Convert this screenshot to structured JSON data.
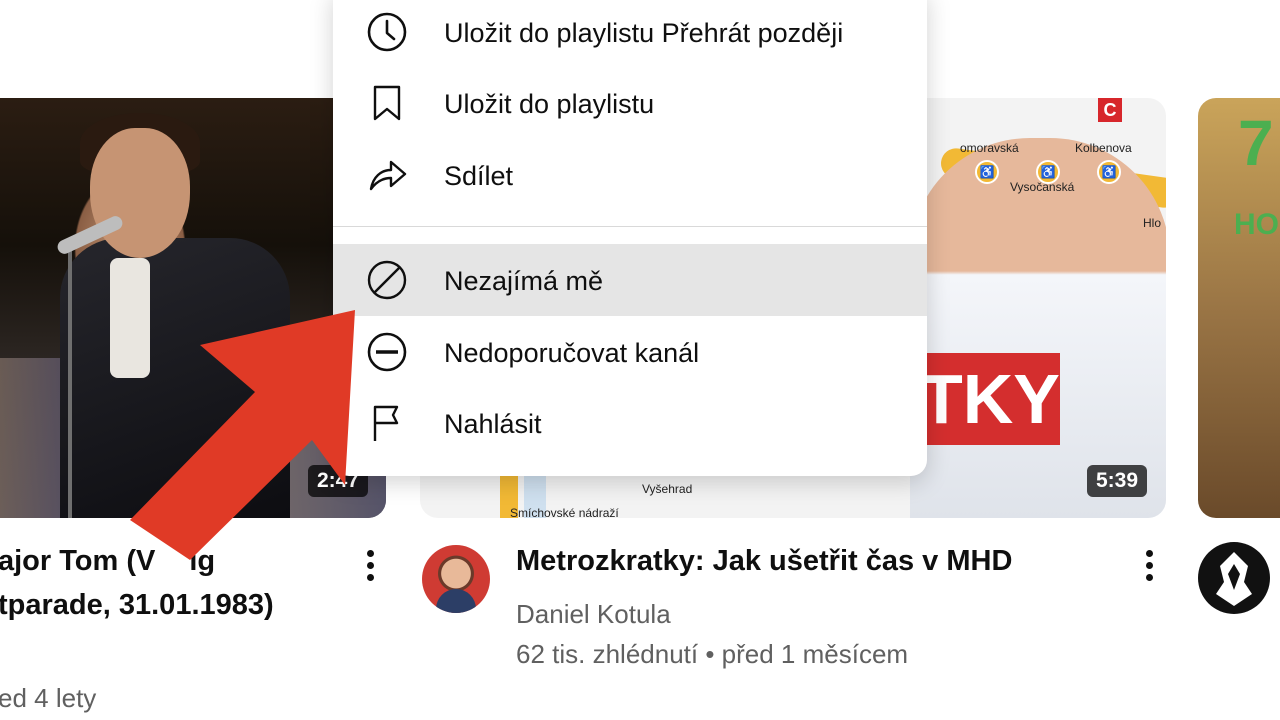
{
  "menu": {
    "items": [
      {
        "label": "Uložit do playlistu Přehrát později",
        "icon": "clock-icon"
      },
      {
        "label": "Uložit do playlistu",
        "icon": "bookmark-icon"
      },
      {
        "label": "Sdílet",
        "icon": "share-icon"
      },
      {
        "label": "Nezajímá mě",
        "icon": "not-interested-icon",
        "highlighted": true
      },
      {
        "label": "Nedoporučovat kanál",
        "icon": "block-channel-icon"
      },
      {
        "label": "Nahlásit",
        "icon": "flag-icon"
      }
    ]
  },
  "videos": [
    {
      "title_line1": "ajor Tom (V",
      "title_line1_tail": "ig",
      "title_line2": "tparade, 31.01.1983)",
      "meta_line": "ed 4 lety",
      "duration": "2:47"
    },
    {
      "title": "Metrozkratky: Jak ušetřit čas v MHD",
      "channel": "Daniel Kotula",
      "meta_line": "62 tis. zhlédnutí • před 1 měsícem",
      "duration": "5:39",
      "thumb_banner": "TKY",
      "thumb_logo": "C",
      "map_labels": [
        "omoravská",
        "Kolbenova",
        "Vysočanská",
        "Hlo",
        "Vyšehrad",
        "Smíchovské nádraží"
      ]
    },
    {
      "thumb_text_top": "7",
      "thumb_text_mid": "HO"
    }
  ],
  "colors": {
    "arrow": "#e03a26",
    "highlight": "#e5e5e5",
    "secondary_text": "#606060"
  }
}
